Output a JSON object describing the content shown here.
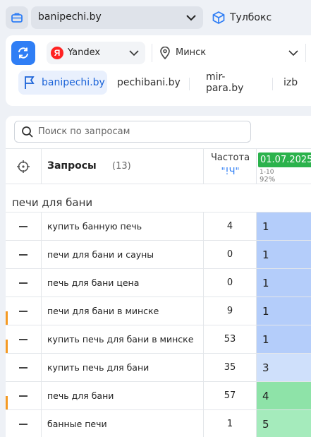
{
  "header": {
    "project": "banipechi.by",
    "toolbox_label": "Тулбокс"
  },
  "filters": {
    "engine": "Yandex",
    "engine_logo": "Я",
    "region": "Минск",
    "sites": [
      "banipechi.by",
      "pechibani.by",
      "mir-para.by",
      "izb"
    ],
    "active_site": "banipechi.by"
  },
  "search": {
    "placeholder": "Поиск по запросам"
  },
  "table": {
    "queries_header": "Запросы",
    "queries_count": "(13)",
    "freq_header": "Частота",
    "freq_sub": "\"!Ч\"",
    "date": "01.07.2025",
    "date_range": "1-10",
    "date_percent": "92%",
    "group": "печи для бани",
    "rows": [
      {
        "query": "купить банную печь",
        "freq": "4",
        "pos": "1",
        "color": "#b4cdfa",
        "marker": ""
      },
      {
        "query": "печи для бани и сауны",
        "freq": "0",
        "pos": "1",
        "color": "#b4cdfa",
        "marker": ""
      },
      {
        "query": "печь для бани цена",
        "freq": "0",
        "pos": "1",
        "color": "#b4cdfa",
        "marker": ""
      },
      {
        "query": "печи для бани в минске",
        "freq": "9",
        "pos": "1",
        "color": "#b4cdfa",
        "marker": "#f59a23"
      },
      {
        "query": "купить печь для бани в минске",
        "freq": "53",
        "pos": "1",
        "color": "#b4cdfa",
        "marker": "#f59a23"
      },
      {
        "query": "купить печь для бани",
        "freq": "35",
        "pos": "3",
        "color": "#cfe0fb",
        "marker": ""
      },
      {
        "query": "печь для бани",
        "freq": "57",
        "pos": "4",
        "color": "#8ee3a8",
        "marker": "#f59a23"
      },
      {
        "query": "банные печи",
        "freq": "1",
        "pos": "5",
        "color": "#a5ebbc",
        "marker": ""
      }
    ]
  }
}
